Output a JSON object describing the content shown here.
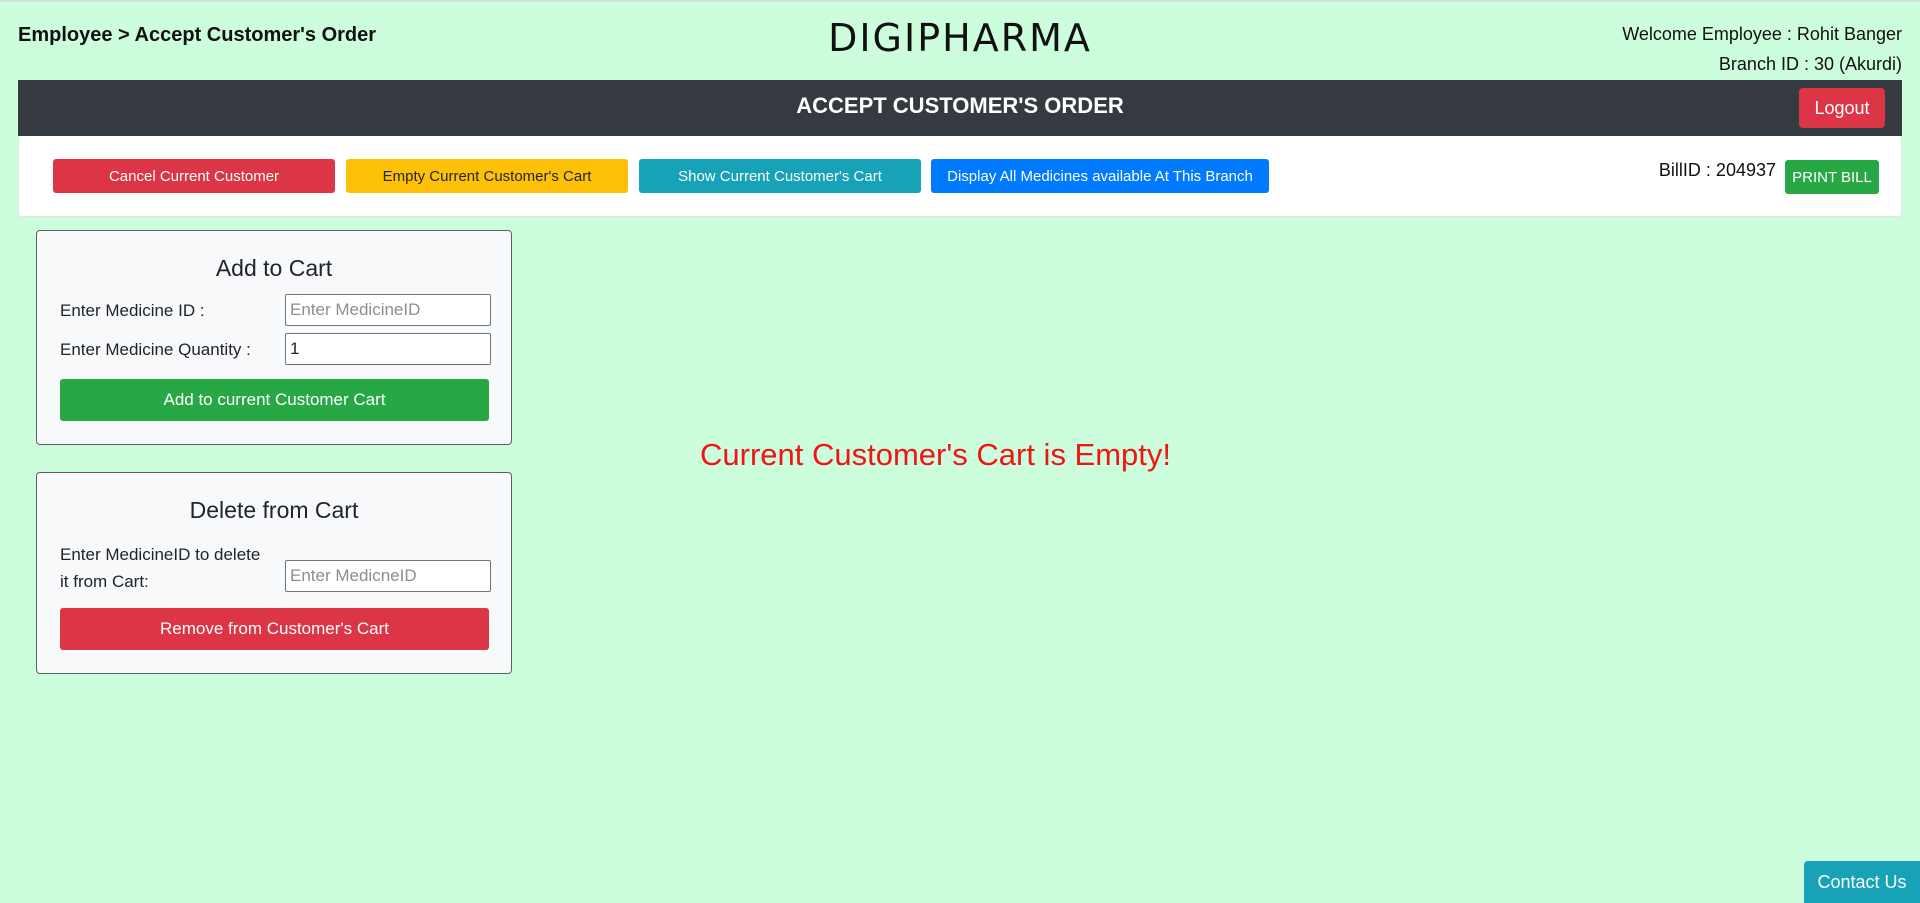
{
  "header": {
    "breadcrumb": "Employee > Accept Customer's Order",
    "brand": "DIGIPHARMA",
    "welcome": "Welcome Employee : Rohit Banger",
    "branch": "Branch ID : 30 (Akurdi)"
  },
  "navbar": {
    "title": "ACCEPT CUSTOMER'S ORDER",
    "logout_label": "Logout"
  },
  "toolbar": {
    "cancel_label": "Cancel Current Customer",
    "empty_label": "Empty Current Customer's Cart",
    "show_label": "Show Current Customer's Cart",
    "display_label": "Display All Medicines available At This Branch",
    "bill_id": "BillID : 204937",
    "print_label": "PRINT BILL"
  },
  "add_card": {
    "title": "Add to Cart",
    "medicine_id_label": "Enter Medicine ID :",
    "medicine_id_placeholder": "Enter MedicineID",
    "medicine_id_value": "",
    "quantity_label": "Enter Medicine Quantity :",
    "quantity_value": "1",
    "submit_label": "Add to current Customer Cart"
  },
  "delete_card": {
    "title": "Delete from Cart",
    "medicine_id_label_line1": "Enter MedicineID to delete",
    "medicine_id_label_line2": "it from Cart:",
    "medicine_id_placeholder": "Enter MedicneID",
    "medicine_id_value": "",
    "submit_label": "Remove from Customer's Cart"
  },
  "cart_message": "Current Customer's Cart is Empty!",
  "footer": {
    "contact_label": "Contact Us"
  },
  "colors": {
    "page_background": "#ccfddc",
    "navbar": "#343a40",
    "danger": "#dc3545",
    "warning": "#ffc107",
    "info": "#17a2b8",
    "primary": "#007bff",
    "success": "#28a745",
    "empty_message": "#f01414"
  }
}
